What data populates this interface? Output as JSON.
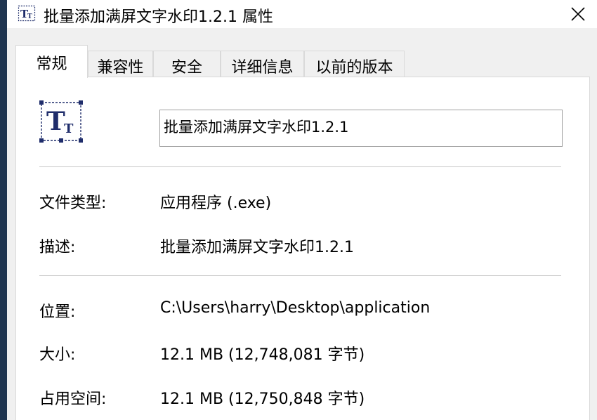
{
  "window": {
    "title": "批量添加满屏文字水印1.2.1 属性",
    "close_glyph": "✕",
    "icon": "text-tt-icon"
  },
  "tabs": [
    {
      "label": "常规",
      "active": true
    },
    {
      "label": "兼容性",
      "active": false
    },
    {
      "label": "安全",
      "active": false
    },
    {
      "label": "详细信息",
      "active": false
    },
    {
      "label": "以前的版本",
      "active": false
    }
  ],
  "general": {
    "name_value": "批量添加满屏文字水印1.2.1",
    "file_type": {
      "label": "文件类型:",
      "value": "应用程序 (.exe)"
    },
    "description": {
      "label": "描述:",
      "value": "批量添加满屏文字水印1.2.1"
    },
    "location": {
      "label": "位置:",
      "value": "C:\\Users\\harry\\Desktop\\application"
    },
    "size": {
      "label": "大小:",
      "value": "12.1 MB (12,748,081 字节)"
    },
    "size_on_disk": {
      "label": "占用空间:",
      "value": "12.1 MB (12,750,848 字节)"
    }
  },
  "colors": {
    "icon_navy": "#1f2d6b",
    "panel_bg": "#ffffff",
    "window_bg": "#f0f0f0"
  }
}
